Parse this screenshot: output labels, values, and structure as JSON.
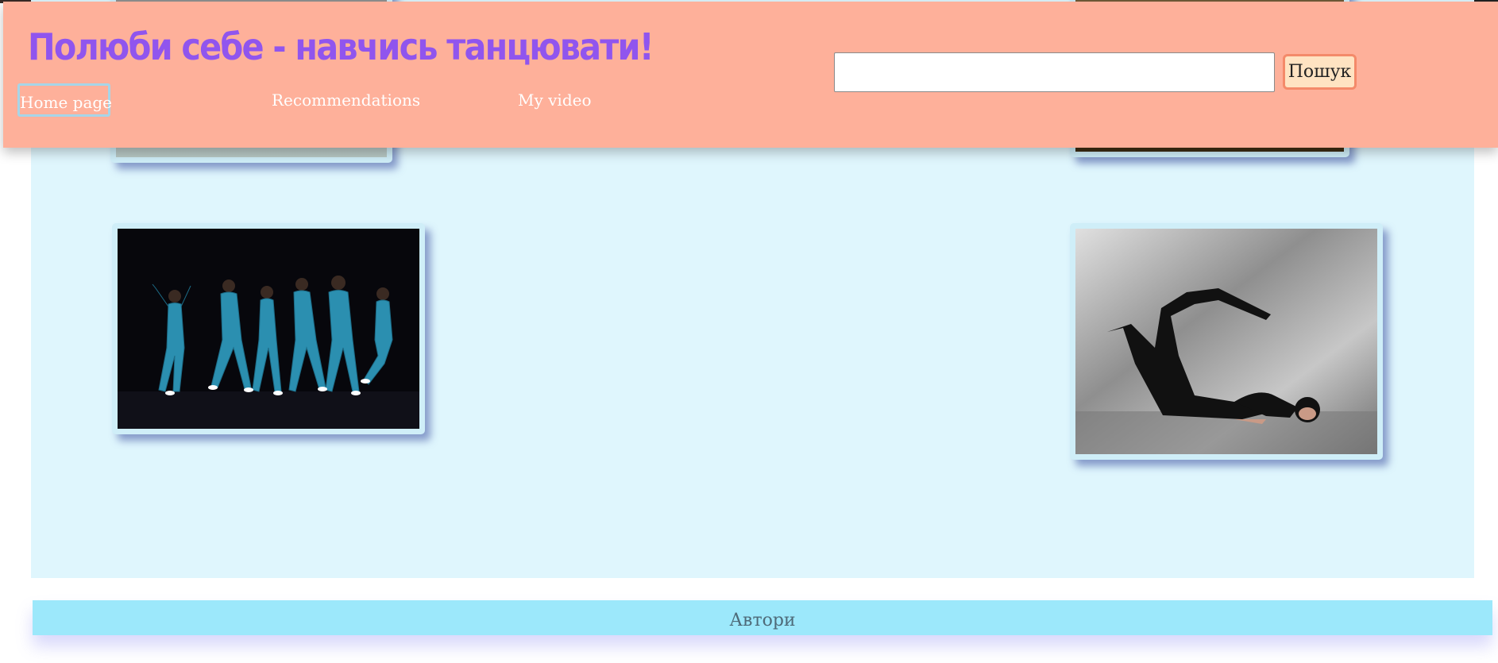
{
  "header": {
    "title": "Полюби себе - навчись танцювати!",
    "nav": [
      {
        "label": "Home page"
      },
      {
        "label": "Recommendations"
      },
      {
        "label": "My video"
      }
    ]
  },
  "search": {
    "value": "",
    "placeholder": "",
    "button_label": "Пошук"
  },
  "footer": {
    "label": "Автори"
  },
  "colors": {
    "header_bg": "#feb09a",
    "title": "#9055ee",
    "main_bg": "#dff6fd",
    "footer_bg": "#9ce8fb",
    "search_button_border": "#f48a6a"
  }
}
